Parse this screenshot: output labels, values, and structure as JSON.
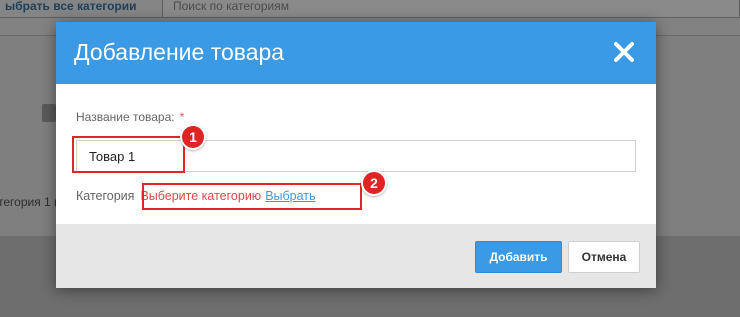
{
  "background": {
    "select_all_button": "ыбрать все категории",
    "search_placeholder": "Поиск по категориям",
    "category_label": "тегория 1 ("
  },
  "modal": {
    "title": "Добавление товара",
    "close_icon": "close-icon",
    "name_field": {
      "label": "Название товара:",
      "required_marker": "*",
      "value": "Товар 1"
    },
    "category": {
      "label": "Категория",
      "placeholder": "Выберите категорию",
      "link": "Выбрать"
    },
    "footer": {
      "add_label": "Добавить",
      "cancel_label": "Отмена"
    }
  },
  "annotations": {
    "badge_1": "1",
    "badge_2": "2"
  },
  "colors": {
    "header": "#3a9ae6",
    "annotation": "#e52525",
    "placeholder": "#e04848"
  }
}
